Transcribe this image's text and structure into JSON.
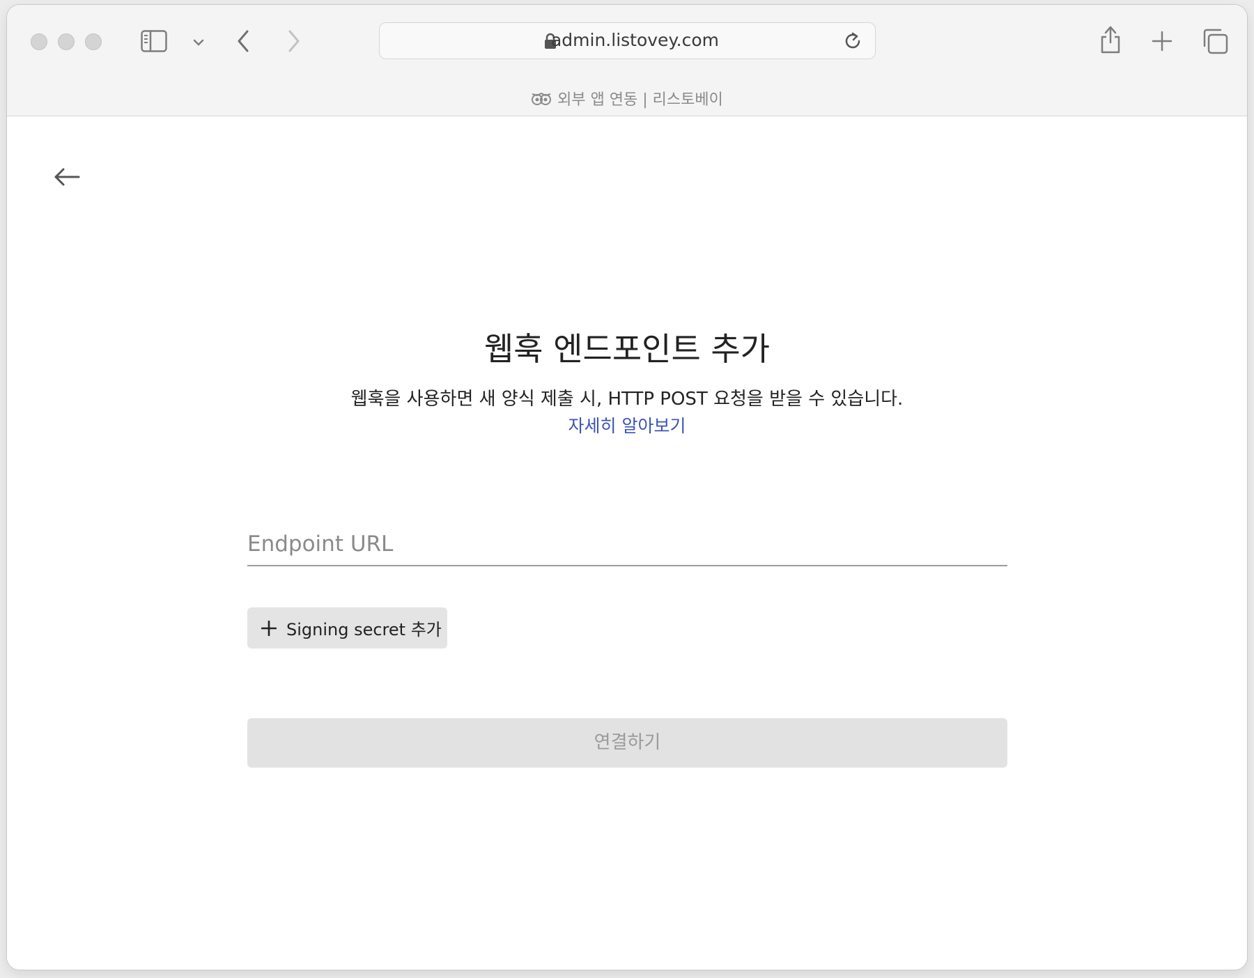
{
  "browser": {
    "url": "admin.listovey.com",
    "tab_title": "외부 앱 연동 | 리스토베이",
    "icons": {
      "sidebar": "sidebar-icon",
      "dropdown": "chevron-down-icon",
      "back": "chevron-left-icon",
      "forward": "chevron-right-icon",
      "lock": "lock-icon",
      "reload": "reload-icon",
      "share": "share-icon",
      "new_tab": "plus-icon",
      "tabs": "tabs-overview-icon",
      "favicon": "owl-icon"
    }
  },
  "page": {
    "back_icon": "arrow-left-icon",
    "title": "웹훅 엔드포인트 추가",
    "description": "웹훅을 사용하면 새 양식 제출 시, HTTP POST 요청을 받을 수 있습니다.",
    "learn_more": "자세히 알아보기",
    "endpoint_placeholder": "Endpoint URL",
    "endpoint_value": "",
    "add_secret_label": "Signing secret 추가",
    "connect_label": "연결하기"
  },
  "colors": {
    "link": "#3c52b8",
    "disabled_button_bg": "#e2e2e2",
    "disabled_button_text": "#9a9a9a"
  }
}
